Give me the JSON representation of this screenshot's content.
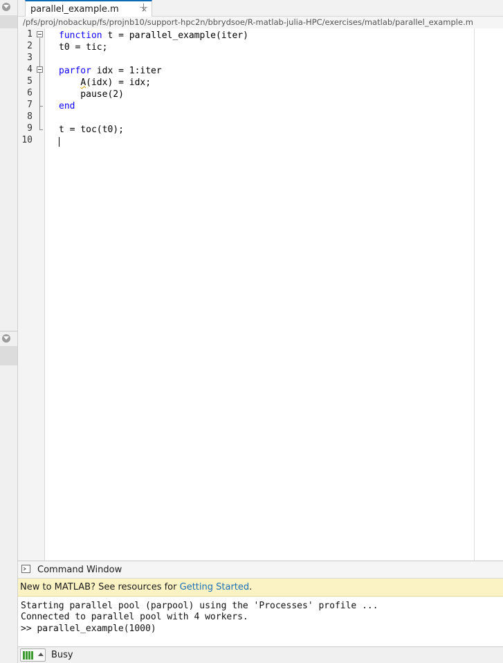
{
  "editor": {
    "tab_title": "parallel_example.m",
    "tab_close": "×",
    "tab_add": "+",
    "file_path": "/pfs/proj/nobackup/fs/projnb10/support-hpc2n/bbrydsoe/R-matlab-julia-HPC/exercises/matlab/parallel_example.m",
    "line_numbers": [
      "1",
      "2",
      "3",
      "4",
      "5",
      "6",
      "7",
      "8",
      "9",
      "10"
    ],
    "code_lines": [
      {
        "kw": "function",
        "rest": " t = parallel_example(iter)"
      },
      {
        "kw": "",
        "rest": "t0 = tic;"
      },
      {
        "kw": "",
        "rest": ""
      },
      {
        "kw": "parfor",
        "rest": " idx = 1:iter"
      },
      {
        "indent": "    ",
        "warn": "A",
        "rest": "(idx) = idx;"
      },
      {
        "kw": "",
        "rest": "    pause(2)"
      },
      {
        "kw": "end",
        "rest": ""
      },
      {
        "kw": "",
        "rest": ""
      },
      {
        "kw": "",
        "rest": "t = toc(t0);"
      },
      {
        "kw": "",
        "rest": ""
      }
    ]
  },
  "command_window": {
    "title": "Command Window",
    "banner_text": "New to MATLAB? See resources for ",
    "banner_link": "Getting Started",
    "banner_end": ".",
    "output_lines": [
      "Starting parallel pool (parpool) using the 'Processes' profile ...",
      "Connected to parallel pool with 4 workers.",
      ">> parallel_example(1000)"
    ]
  },
  "status_bar": {
    "status_text": "Busy"
  },
  "colors": {
    "keyword": "#0e00ff",
    "link": "#1c6fb4",
    "banner_bg": "#fbf3c4",
    "busy_green": "#3a9a2e",
    "tab_accent": "#0e6bb3"
  }
}
